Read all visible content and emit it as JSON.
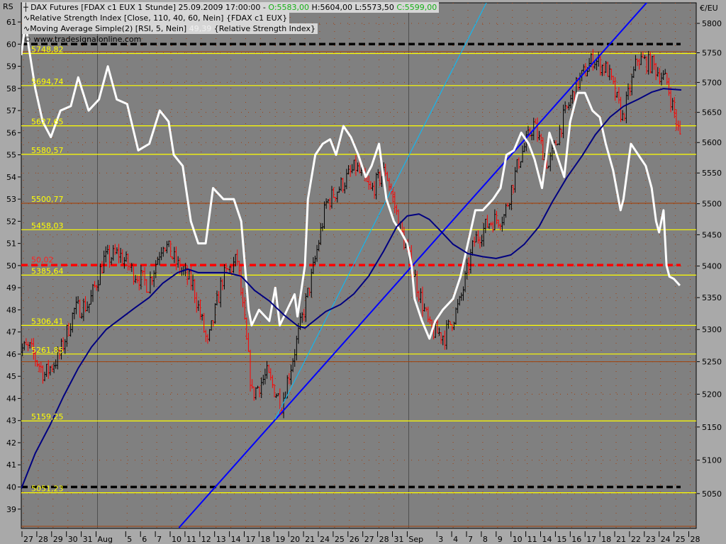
{
  "header": {
    "instrument": "DAX Futures [FDAX c1 EUX  1 Stunde] 25.09.2009 17:00:00 -",
    "open": "O:5583,00",
    "high": "H:5604,00",
    "low": "L:5573,50",
    "close": "C:5599,00",
    "indicator1": "Relative Strength Index [Close, 110, 40, 60, Nein] {FDAX c1 EUX}",
    "indicator2": "Moving Average Simple(2) [RSI, 5, Nein]",
    "indicator2_value": "49,39",
    "indicator2_source": "{Relative Strength Index}",
    "watermark": "© www.tradesignalonline.com",
    "left_axis_title": "RS",
    "right_axis_title": "€/EU"
  },
  "colors": {
    "plot_bg": "#808080",
    "up_bar": "#000000",
    "down_bar": "#ff0000",
    "rsi_ma": "#ffffff",
    "rsi": "#000080",
    "trendline": "#0000ff",
    "trendline2": "#00bfff",
    "level": "#ffff00",
    "level_brown": "#a0400a",
    "rsi_mid": "#ff0000",
    "rsi_bounds": "#000000"
  },
  "chart_data": {
    "type": "line",
    "title": "DAX Futures [FDAX c1 EUX 1 Stunde]",
    "left_axis": {
      "label": "RS",
      "range": [
        39,
        61
      ],
      "ticks": [
        39,
        40,
        41,
        42,
        43,
        44,
        45,
        46,
        47,
        48,
        49,
        50,
        51,
        52,
        53,
        54,
        55,
        56,
        57,
        58,
        59,
        60,
        61
      ]
    },
    "right_axis": {
      "label": "€/EU",
      "scale": "log",
      "ticks": [
        5050,
        5100,
        5150,
        5200,
        5250,
        5300,
        5350,
        5400,
        5450,
        5500,
        5550,
        5600,
        5650,
        5700,
        5750,
        5800
      ]
    },
    "x_labels": [
      {
        "day": 0,
        "label": "27"
      },
      {
        "day": 1,
        "label": "28"
      },
      {
        "day": 2,
        "label": "29"
      },
      {
        "day": 3,
        "label": "30"
      },
      {
        "day": 4,
        "label": "31"
      },
      {
        "day": 5,
        "label": "Aug"
      },
      {
        "day": 7,
        "label": "5"
      },
      {
        "day": 8,
        "label": "6"
      },
      {
        "day": 9,
        "label": "7"
      },
      {
        "day": 10,
        "label": "10"
      },
      {
        "day": 11,
        "label": "11"
      },
      {
        "day": 12,
        "label": "12"
      },
      {
        "day": 13,
        "label": "13"
      },
      {
        "day": 14,
        "label": "14"
      },
      {
        "day": 15,
        "label": "17"
      },
      {
        "day": 16,
        "label": "18"
      },
      {
        "day": 17,
        "label": "19"
      },
      {
        "day": 18,
        "label": "20"
      },
      {
        "day": 19,
        "label": "21"
      },
      {
        "day": 20,
        "label": "24"
      },
      {
        "day": 21,
        "label": "25"
      },
      {
        "day": 22,
        "label": "26"
      },
      {
        "day": 23,
        "label": "27"
      },
      {
        "day": 24,
        "label": "28"
      },
      {
        "day": 25,
        "label": "31"
      },
      {
        "day": 26,
        "label": "Sep"
      },
      {
        "day": 28,
        "label": "3"
      },
      {
        "day": 29,
        "label": "4"
      },
      {
        "day": 30,
        "label": "7"
      },
      {
        "day": 31,
        "label": "8"
      },
      {
        "day": 32,
        "label": "9"
      },
      {
        "day": 33,
        "label": "10"
      },
      {
        "day": 34,
        "label": "11"
      },
      {
        "day": 35,
        "label": "14"
      },
      {
        "day": 36,
        "label": "15"
      },
      {
        "day": 37,
        "label": "16"
      },
      {
        "day": 38,
        "label": "17"
      },
      {
        "day": 39,
        "label": "18"
      },
      {
        "day": 40,
        "label": "21"
      },
      {
        "day": 41,
        "label": "22"
      },
      {
        "day": 42,
        "label": "23"
      },
      {
        "day": 43,
        "label": "24"
      },
      {
        "day": 44,
        "label": "25"
      },
      {
        "day": 45,
        "label": "28"
      }
    ],
    "price_daily_close": [
      5270,
      5230,
      5260,
      5330,
      5340,
      5410,
      5420,
      5390,
      5370,
      5440,
      5400,
      5370,
      5275,
      5380,
      5410,
      5200,
      5230,
      5185,
      5280,
      5380,
      5500,
      5530,
      5560,
      5520,
      5555,
      5460,
      5380,
      5300,
      5290,
      5340,
      5440,
      5470,
      5480,
      5570,
      5630,
      5560,
      5640,
      5700,
      5740,
      5720,
      5640,
      5740,
      5730,
      5700,
      5595
    ],
    "levels": [
      {
        "price": 5748.82,
        "label": "5748,82",
        "color": "level"
      },
      {
        "price": 5694.74,
        "label": "5694,74",
        "color": "level"
      },
      {
        "price": 5627.65,
        "label": "5627,65",
        "color": "level"
      },
      {
        "price": 5580.57,
        "label": "5580,57",
        "color": "level"
      },
      {
        "price": 5500.77,
        "label": "5500,77",
        "color": "level_brown"
      },
      {
        "price": 5458.03,
        "label": "5458,03",
        "color": "level"
      },
      {
        "price": 5385.64,
        "label": "5385,64",
        "color": "level"
      },
      {
        "price": 5306.41,
        "label": "5306,41",
        "color": "level"
      },
      {
        "price": 5261.85,
        "label": "5261,85",
        "color": "level"
      },
      {
        "price": 5159.25,
        "label": "5159,25",
        "color": "level"
      },
      {
        "price": 5051.23,
        "label": "5051,23",
        "color": "level"
      }
    ],
    "brown_lines": [
      5752,
      5250
    ],
    "rsi_levels": [
      {
        "value": 60,
        "label": "",
        "color": "rsi_bounds"
      },
      {
        "value": 50.02,
        "label": "50,02",
        "color": "rsi_mid"
      },
      {
        "value": 40,
        "label": "",
        "color": "rsi_bounds"
      }
    ],
    "series": [
      {
        "name": "Moving Average Simple(2) of RSI",
        "color": "rsi_ma",
        "points": [
          [
            -0.15,
            59.5
          ],
          [
            0.15,
            61
          ],
          [
            0.33,
            60
          ],
          [
            0.8,
            58
          ],
          [
            1.3,
            56.5
          ],
          [
            1.85,
            55.8
          ],
          [
            2.5,
            57
          ],
          [
            3.2,
            57.2
          ],
          [
            3.7,
            58.5
          ],
          [
            4.4,
            57
          ],
          [
            5.1,
            57.5
          ],
          [
            5.7,
            59
          ],
          [
            6.3,
            57.5
          ],
          [
            7.0,
            57.3
          ],
          [
            7.75,
            55.2
          ],
          [
            8.5,
            55.5
          ],
          [
            9.2,
            57
          ],
          [
            9.8,
            56.5
          ],
          [
            10.15,
            55
          ],
          [
            10.75,
            54.5
          ],
          [
            11.3,
            52
          ],
          [
            11.8,
            51
          ],
          [
            12.3,
            51
          ],
          [
            12.8,
            53.5
          ],
          [
            13.5,
            53
          ],
          [
            14.2,
            53
          ],
          [
            14.7,
            52
          ],
          [
            15.2,
            48
          ],
          [
            15.4,
            47.3
          ],
          [
            15.9,
            48
          ],
          [
            16.6,
            47.5
          ],
          [
            17.0,
            49
          ],
          [
            17.3,
            47.3
          ],
          [
            17.8,
            48
          ],
          [
            18.3,
            48.7
          ],
          [
            18.5,
            47.7
          ],
          [
            19.0,
            50
          ],
          [
            19.2,
            53
          ],
          [
            19.7,
            55
          ],
          [
            20.2,
            55.5
          ],
          [
            20.7,
            55.7
          ],
          [
            21.1,
            55
          ],
          [
            21.6,
            56.3
          ],
          [
            22.1,
            55.8
          ],
          [
            22.6,
            55
          ],
          [
            23.1,
            54
          ],
          [
            23.5,
            54.5
          ],
          [
            24.0,
            55.5
          ],
          [
            24.5,
            53
          ],
          [
            25.0,
            52
          ],
          [
            25.5,
            51.5
          ],
          [
            25.9,
            51
          ],
          [
            26.2,
            50
          ],
          [
            26.4,
            48.5
          ],
          [
            26.9,
            47.5
          ],
          [
            27.4,
            46.7
          ],
          [
            27.8,
            47.5
          ],
          [
            28.3,
            48
          ],
          [
            29.0,
            48.5
          ],
          [
            29.5,
            49.5
          ],
          [
            30.0,
            51
          ],
          [
            30.5,
            52.5
          ],
          [
            31.0,
            52.5
          ],
          [
            31.7,
            53
          ],
          [
            32.2,
            53.5
          ],
          [
            32.6,
            55
          ],
          [
            33.1,
            55.2
          ],
          [
            33.6,
            56
          ],
          [
            34.1,
            55.5
          ],
          [
            34.5,
            54.8
          ],
          [
            35.0,
            53.5
          ],
          [
            35.5,
            56
          ],
          [
            36.0,
            55
          ],
          [
            36.5,
            54
          ],
          [
            36.9,
            56.5
          ],
          [
            37.4,
            57.8
          ],
          [
            37.9,
            57.8
          ],
          [
            38.4,
            57
          ],
          [
            38.9,
            56.7
          ],
          [
            39.3,
            55.5
          ],
          [
            39.8,
            54.3
          ],
          [
            40.3,
            52.5
          ],
          [
            40.5,
            53
          ],
          [
            41.0,
            55.5
          ],
          [
            41.5,
            55
          ],
          [
            42.0,
            54.5
          ],
          [
            42.4,
            53.5
          ],
          [
            42.7,
            52
          ],
          [
            42.9,
            51.5
          ],
          [
            43.2,
            52.5
          ],
          [
            43.4,
            50
          ],
          [
            43.6,
            49.5
          ],
          [
            43.9,
            49.4
          ],
          [
            44.3,
            49.1
          ]
        ]
      },
      {
        "name": "Relative Strength Index (110)",
        "color": "rsi",
        "points": [
          [
            -0.15,
            39.92
          ],
          [
            0.8,
            41.52
          ],
          [
            1.8,
            42.8
          ],
          [
            2.7,
            44.08
          ],
          [
            3.7,
            45.36
          ],
          [
            4.6,
            46.32
          ],
          [
            5.6,
            47.12
          ],
          [
            6.55,
            47.6
          ],
          [
            7.5,
            48.08
          ],
          [
            8.5,
            48.56
          ],
          [
            9.4,
            49.2
          ],
          [
            10.4,
            49.68
          ],
          [
            11.1,
            49.84
          ],
          [
            11.8,
            49.68
          ],
          [
            12.8,
            49.68
          ],
          [
            13.7,
            49.68
          ],
          [
            14.7,
            49.52
          ],
          [
            15.6,
            48.88
          ],
          [
            16.6,
            48.4
          ],
          [
            17.6,
            47.76
          ],
          [
            18.5,
            47.28
          ],
          [
            19.0,
            47.18
          ],
          [
            19.5,
            47.44
          ],
          [
            20.4,
            47.92
          ],
          [
            21.4,
            48.24
          ],
          [
            22.3,
            48.72
          ],
          [
            23.3,
            49.52
          ],
          [
            24.3,
            50.64
          ],
          [
            25.2,
            51.76
          ],
          [
            25.9,
            52.24
          ],
          [
            26.7,
            52.33
          ],
          [
            27.4,
            52.08
          ],
          [
            28.1,
            51.6
          ],
          [
            29.0,
            50.96
          ],
          [
            30.0,
            50.54
          ],
          [
            31.0,
            50.4
          ],
          [
            31.9,
            50.32
          ],
          [
            32.9,
            50.48
          ],
          [
            33.8,
            50.96
          ],
          [
            34.8,
            51.76
          ],
          [
            35.7,
            52.88
          ],
          [
            36.7,
            54.0
          ],
          [
            37.7,
            54.95
          ],
          [
            38.6,
            55.91
          ],
          [
            39.6,
            56.71
          ],
          [
            40.5,
            57.19
          ],
          [
            41.5,
            57.51
          ],
          [
            42.4,
            57.83
          ],
          [
            43.2,
            57.99
          ],
          [
            44.4,
            57.93
          ]
        ]
      }
    ],
    "trendlines": [
      {
        "name": "blue trendline",
        "color": "trendline",
        "from": [
          10.5,
          38.16
        ],
        "to": [
          42.1,
          61.9
        ]
      },
      {
        "name": "cyan trendline",
        "color": "trendline2",
        "from": [
          17.0,
          43.07
        ],
        "to": [
          31.3,
          61.94
        ]
      }
    ]
  }
}
